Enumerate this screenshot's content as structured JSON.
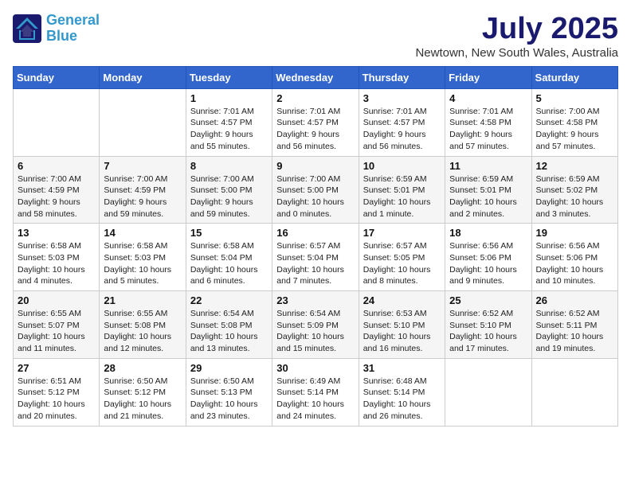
{
  "header": {
    "logo_line1": "General",
    "logo_line2": "Blue",
    "month": "July 2025",
    "location": "Newtown, New South Wales, Australia"
  },
  "weekdays": [
    "Sunday",
    "Monday",
    "Tuesday",
    "Wednesday",
    "Thursday",
    "Friday",
    "Saturday"
  ],
  "weeks": [
    [
      {
        "day": "",
        "info": ""
      },
      {
        "day": "",
        "info": ""
      },
      {
        "day": "1",
        "info": "Sunrise: 7:01 AM\nSunset: 4:57 PM\nDaylight: 9 hours and 55 minutes."
      },
      {
        "day": "2",
        "info": "Sunrise: 7:01 AM\nSunset: 4:57 PM\nDaylight: 9 hours and 56 minutes."
      },
      {
        "day": "3",
        "info": "Sunrise: 7:01 AM\nSunset: 4:57 PM\nDaylight: 9 hours and 56 minutes."
      },
      {
        "day": "4",
        "info": "Sunrise: 7:01 AM\nSunset: 4:58 PM\nDaylight: 9 hours and 57 minutes."
      },
      {
        "day": "5",
        "info": "Sunrise: 7:00 AM\nSunset: 4:58 PM\nDaylight: 9 hours and 57 minutes."
      }
    ],
    [
      {
        "day": "6",
        "info": "Sunrise: 7:00 AM\nSunset: 4:59 PM\nDaylight: 9 hours and 58 minutes."
      },
      {
        "day": "7",
        "info": "Sunrise: 7:00 AM\nSunset: 4:59 PM\nDaylight: 9 hours and 59 minutes."
      },
      {
        "day": "8",
        "info": "Sunrise: 7:00 AM\nSunset: 5:00 PM\nDaylight: 9 hours and 59 minutes."
      },
      {
        "day": "9",
        "info": "Sunrise: 7:00 AM\nSunset: 5:00 PM\nDaylight: 10 hours and 0 minutes."
      },
      {
        "day": "10",
        "info": "Sunrise: 6:59 AM\nSunset: 5:01 PM\nDaylight: 10 hours and 1 minute."
      },
      {
        "day": "11",
        "info": "Sunrise: 6:59 AM\nSunset: 5:01 PM\nDaylight: 10 hours and 2 minutes."
      },
      {
        "day": "12",
        "info": "Sunrise: 6:59 AM\nSunset: 5:02 PM\nDaylight: 10 hours and 3 minutes."
      }
    ],
    [
      {
        "day": "13",
        "info": "Sunrise: 6:58 AM\nSunset: 5:03 PM\nDaylight: 10 hours and 4 minutes."
      },
      {
        "day": "14",
        "info": "Sunrise: 6:58 AM\nSunset: 5:03 PM\nDaylight: 10 hours and 5 minutes."
      },
      {
        "day": "15",
        "info": "Sunrise: 6:58 AM\nSunset: 5:04 PM\nDaylight: 10 hours and 6 minutes."
      },
      {
        "day": "16",
        "info": "Sunrise: 6:57 AM\nSunset: 5:04 PM\nDaylight: 10 hours and 7 minutes."
      },
      {
        "day": "17",
        "info": "Sunrise: 6:57 AM\nSunset: 5:05 PM\nDaylight: 10 hours and 8 minutes."
      },
      {
        "day": "18",
        "info": "Sunrise: 6:56 AM\nSunset: 5:06 PM\nDaylight: 10 hours and 9 minutes."
      },
      {
        "day": "19",
        "info": "Sunrise: 6:56 AM\nSunset: 5:06 PM\nDaylight: 10 hours and 10 minutes."
      }
    ],
    [
      {
        "day": "20",
        "info": "Sunrise: 6:55 AM\nSunset: 5:07 PM\nDaylight: 10 hours and 11 minutes."
      },
      {
        "day": "21",
        "info": "Sunrise: 6:55 AM\nSunset: 5:08 PM\nDaylight: 10 hours and 12 minutes."
      },
      {
        "day": "22",
        "info": "Sunrise: 6:54 AM\nSunset: 5:08 PM\nDaylight: 10 hours and 13 minutes."
      },
      {
        "day": "23",
        "info": "Sunrise: 6:54 AM\nSunset: 5:09 PM\nDaylight: 10 hours and 15 minutes."
      },
      {
        "day": "24",
        "info": "Sunrise: 6:53 AM\nSunset: 5:10 PM\nDaylight: 10 hours and 16 minutes."
      },
      {
        "day": "25",
        "info": "Sunrise: 6:52 AM\nSunset: 5:10 PM\nDaylight: 10 hours and 17 minutes."
      },
      {
        "day": "26",
        "info": "Sunrise: 6:52 AM\nSunset: 5:11 PM\nDaylight: 10 hours and 19 minutes."
      }
    ],
    [
      {
        "day": "27",
        "info": "Sunrise: 6:51 AM\nSunset: 5:12 PM\nDaylight: 10 hours and 20 minutes."
      },
      {
        "day": "28",
        "info": "Sunrise: 6:50 AM\nSunset: 5:12 PM\nDaylight: 10 hours and 21 minutes."
      },
      {
        "day": "29",
        "info": "Sunrise: 6:50 AM\nSunset: 5:13 PM\nDaylight: 10 hours and 23 minutes."
      },
      {
        "day": "30",
        "info": "Sunrise: 6:49 AM\nSunset: 5:14 PM\nDaylight: 10 hours and 24 minutes."
      },
      {
        "day": "31",
        "info": "Sunrise: 6:48 AM\nSunset: 5:14 PM\nDaylight: 10 hours and 26 minutes."
      },
      {
        "day": "",
        "info": ""
      },
      {
        "day": "",
        "info": ""
      }
    ]
  ]
}
